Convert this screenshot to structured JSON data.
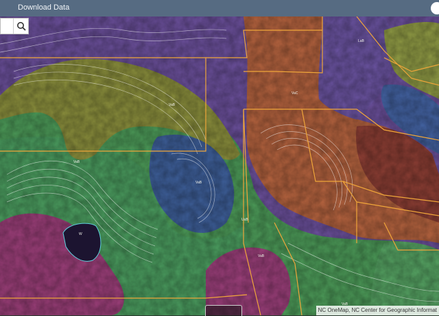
{
  "header": {
    "title": "Download Data"
  },
  "search": {
    "placeholder": ""
  },
  "attribution": "NC OneMap, NC Center for Geographic Informat",
  "map": {
    "labels": [
      "VaB",
      "VaB",
      "VaB",
      "VaC",
      "LaB",
      "UuB",
      "W",
      "VaB",
      "VaB"
    ],
    "soil_colors": {
      "purple": "#6c4f9c",
      "green": "#4d9a5a",
      "olive": "#8a8f3a",
      "orange": "#b4653f",
      "magenta": "#9a3f78",
      "blue": "#3f5f9a"
    },
    "boundary_color": "#f0a63a"
  }
}
